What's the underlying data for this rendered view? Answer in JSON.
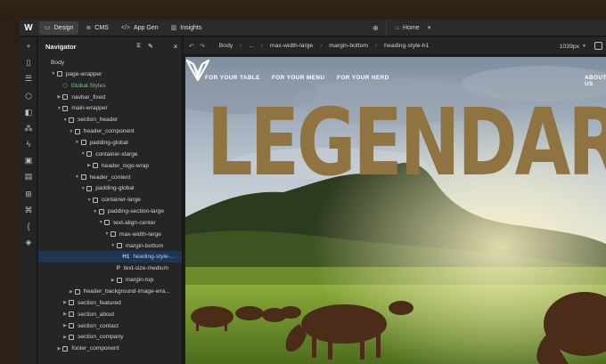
{
  "topbar": {
    "logo": "W",
    "tabs": [
      {
        "label": "Design",
        "icon": "design-icon"
      },
      {
        "label": "CMS",
        "icon": "database-icon"
      },
      {
        "label": "App Gen",
        "icon": "code-icon"
      },
      {
        "label": "Insights",
        "icon": "chart-icon"
      }
    ],
    "page_select": "Home"
  },
  "navigator": {
    "title": "Navigator",
    "tree": [
      {
        "label": "Body",
        "depth": 0,
        "kind": "body"
      },
      {
        "label": "page-wrapper",
        "depth": 1,
        "kind": "box",
        "caret": "open"
      },
      {
        "label": "Global Styles",
        "depth": 2,
        "kind": "global"
      },
      {
        "label": "navbar_fixed",
        "depth": 2,
        "kind": "box",
        "caret": "closed"
      },
      {
        "label": "main-wrapper",
        "depth": 2,
        "kind": "box",
        "caret": "open"
      },
      {
        "label": "section_header",
        "depth": 3,
        "kind": "box",
        "caret": "open"
      },
      {
        "label": "header_component",
        "depth": 4,
        "kind": "box",
        "caret": "open"
      },
      {
        "label": "padding-global",
        "depth": 5,
        "kind": "box",
        "caret": "open"
      },
      {
        "label": "container-xlarge",
        "depth": 6,
        "kind": "box",
        "caret": "open"
      },
      {
        "label": "header_logo-wrap",
        "depth": 7,
        "kind": "box",
        "caret": "closed"
      },
      {
        "label": "header_content",
        "depth": 5,
        "kind": "box",
        "caret": "open"
      },
      {
        "label": "padding-global",
        "depth": 6,
        "kind": "box",
        "caret": "open"
      },
      {
        "label": "container-large",
        "depth": 7,
        "kind": "box",
        "caret": "open"
      },
      {
        "label": "padding-section-large",
        "depth": 8,
        "kind": "box",
        "caret": "open"
      },
      {
        "label": "text-align-center",
        "depth": 9,
        "kind": "box",
        "caret": "open"
      },
      {
        "label": "max-width-large",
        "depth": 10,
        "kind": "box",
        "caret": "open"
      },
      {
        "label": "margin-bottom",
        "depth": 11,
        "kind": "box",
        "caret": "open"
      },
      {
        "label": "heading-style-...",
        "depth": 12,
        "kind": "h1",
        "selected": true
      },
      {
        "label": "text-size-medium",
        "depth": 11,
        "kind": "p"
      },
      {
        "label": "margin-top",
        "depth": 11,
        "kind": "box",
        "caret": "closed"
      },
      {
        "label": "header_background-image-wra...",
        "depth": 4,
        "kind": "box",
        "caret": "closed"
      },
      {
        "label": "section_featured",
        "depth": 3,
        "kind": "box",
        "caret": "closed"
      },
      {
        "label": "section_about",
        "depth": 3,
        "kind": "box",
        "caret": "closed"
      },
      {
        "label": "section_contact",
        "depth": 3,
        "kind": "box",
        "caret": "closed"
      },
      {
        "label": "section_company",
        "depth": 3,
        "kind": "box",
        "caret": "closed"
      },
      {
        "label": "footer_component",
        "depth": 2,
        "kind": "box",
        "caret": "closed"
      }
    ],
    "tags": {
      "h1": "H1",
      "p": "P"
    }
  },
  "canvas": {
    "breadcrumbs": [
      "Body",
      "...",
      "max-width-large",
      "margin-bottom",
      "heading-style-h1"
    ],
    "breakpoint": "1039px"
  },
  "site": {
    "nav": [
      "FOR YOUR TABLE",
      "FOR YOUR MENU",
      "FOR YOUR HERD",
      "ABOUT US"
    ],
    "hero": "LEGENDARY",
    "hero_color": "#8f7442"
  },
  "colors": {
    "selection": "#1f3650",
    "global_styles": "#6fcf7a",
    "accent": "#8f7442"
  }
}
